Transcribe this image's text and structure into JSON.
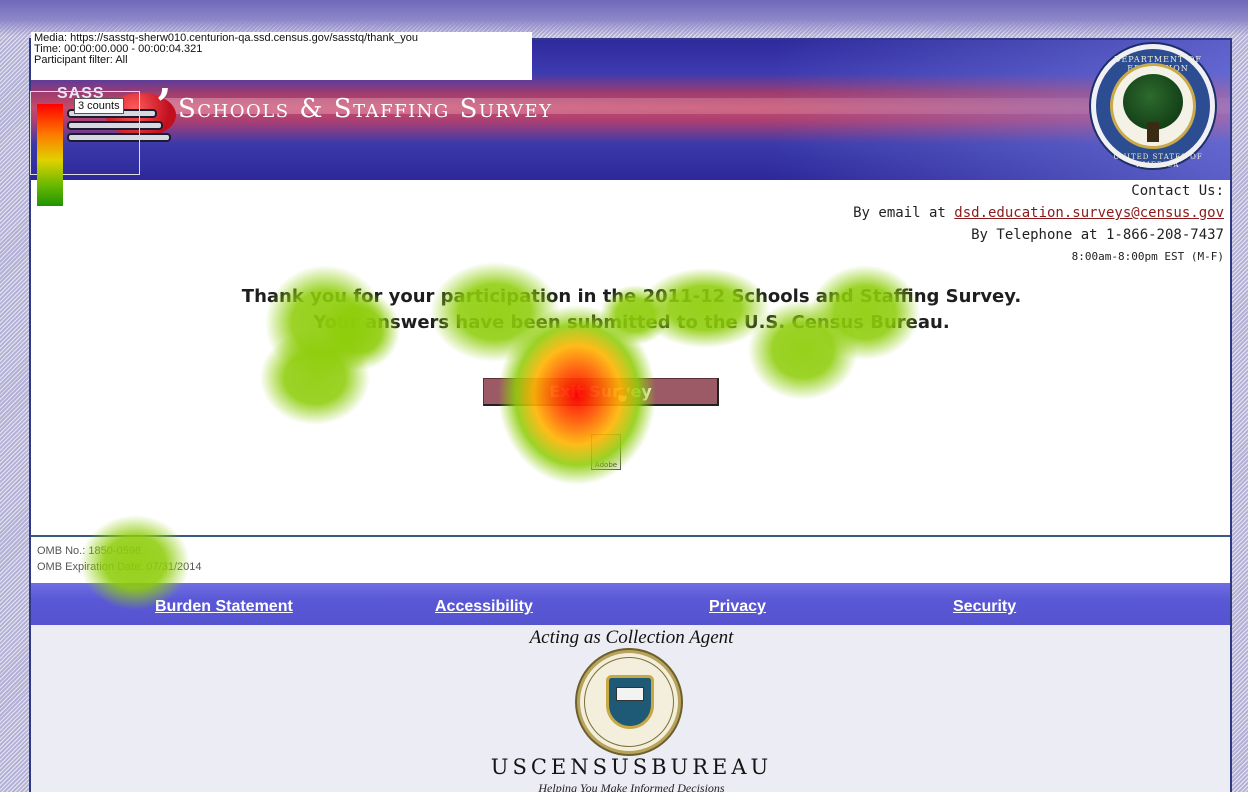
{
  "overlay": {
    "media": "Media: https://sasstq-sherw010.centurion-qa.ssd.census.gov/sasstq/thank_you",
    "time": "Time: 00:00:00.000 - 00:00:04.321",
    "participant_filter": "Participant filter: All",
    "legend_label": "3 counts",
    "legend_colors": [
      "#ff0000",
      "#ff7a00",
      "#e0d100",
      "#68b800",
      "#1f9400"
    ]
  },
  "header": {
    "logo_text": "SASS",
    "title": "Schools & Staffing Survey",
    "seal_top_text": "DEPARTMENT OF EDUCATION",
    "seal_bottom_text": "UNITED STATES OF AMERICA"
  },
  "contact": {
    "heading": "Contact Us:",
    "email_prefix": "By email at ",
    "email": "dsd.education.surveys@census.gov",
    "telephone": "By Telephone at 1-866-208-7437",
    "hours": "8:00am-8:00pm EST (M-F)"
  },
  "main": {
    "thank_you": "Thank you for your participation in the 2011-12 Schools and Staffing Survey.",
    "submitted": "Your answers have been submitted to the U.S. Census Bureau.",
    "exit_button": "Exit Survey",
    "adobe_label": "Adobe"
  },
  "omb": {
    "number": "OMB No.: 1850-0598",
    "expiration": "OMB Expiration Date: 07/31/2014"
  },
  "nav": {
    "burden": "Burden Statement",
    "accessibility": "Accessibility",
    "privacy": "Privacy",
    "security": "Security"
  },
  "footer": {
    "collection_agent": "Acting as Collection Agent",
    "bureau_name": "USCENSUSBUREAU",
    "tagline": "Helping You Make Informed Decisions"
  },
  "colors": {
    "nav_bar": "#5a58d6",
    "exit_button": "#9c5a66",
    "email_link": "#8b1a1a",
    "heatmap_green": "#8ecd0a",
    "heatmap_hot": "#ff0000"
  }
}
